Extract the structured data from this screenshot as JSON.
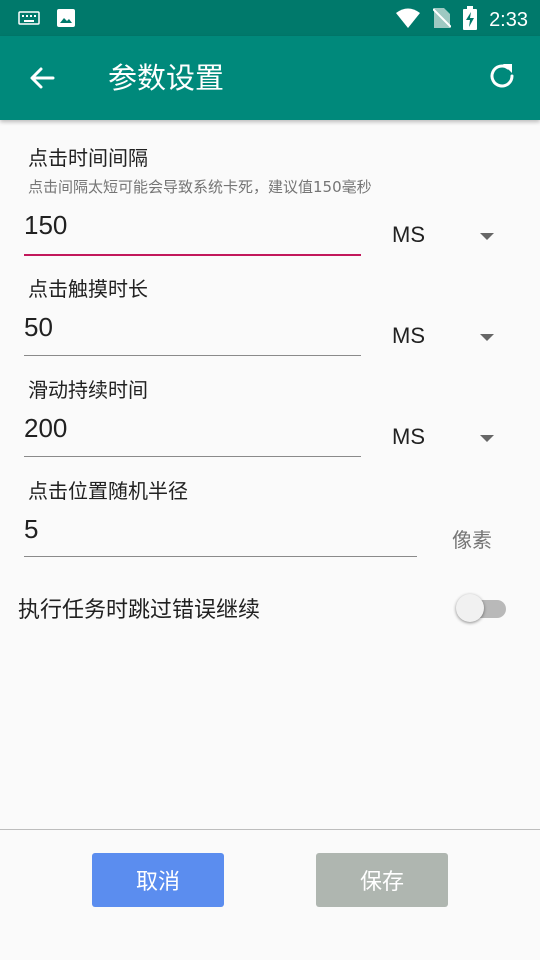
{
  "status_bar": {
    "time": "2:33",
    "icons": [
      "keyboard-icon",
      "image-icon",
      "wifi-icon",
      "no-sim-icon",
      "battery-charging-icon"
    ]
  },
  "app_bar": {
    "title": "参数设置",
    "back_icon": "arrow-back-icon",
    "refresh_icon": "refresh-icon"
  },
  "fields": {
    "click_interval": {
      "label": "点击时间间隔",
      "hint": "点击间隔太短可能会导致系统卡死，建议值150毫秒",
      "value": "150",
      "unit": "MS"
    },
    "touch_duration": {
      "label": "点击触摸时长",
      "value": "50",
      "unit": "MS"
    },
    "swipe_duration": {
      "label": "滑动持续时间",
      "value": "200",
      "unit": "MS"
    },
    "random_radius": {
      "label": "点击位置随机半径",
      "value": "5",
      "unit": "像素"
    }
  },
  "skip_error": {
    "label": "执行任务时跳过错误继续",
    "enabled": false
  },
  "buttons": {
    "cancel": "取消",
    "save": "保存"
  },
  "colors": {
    "status_bar": "#00796b",
    "app_bar": "#00897b",
    "active_underline": "#c2185b",
    "cancel_button": "#5b8def",
    "save_button": "#afb6b0"
  }
}
